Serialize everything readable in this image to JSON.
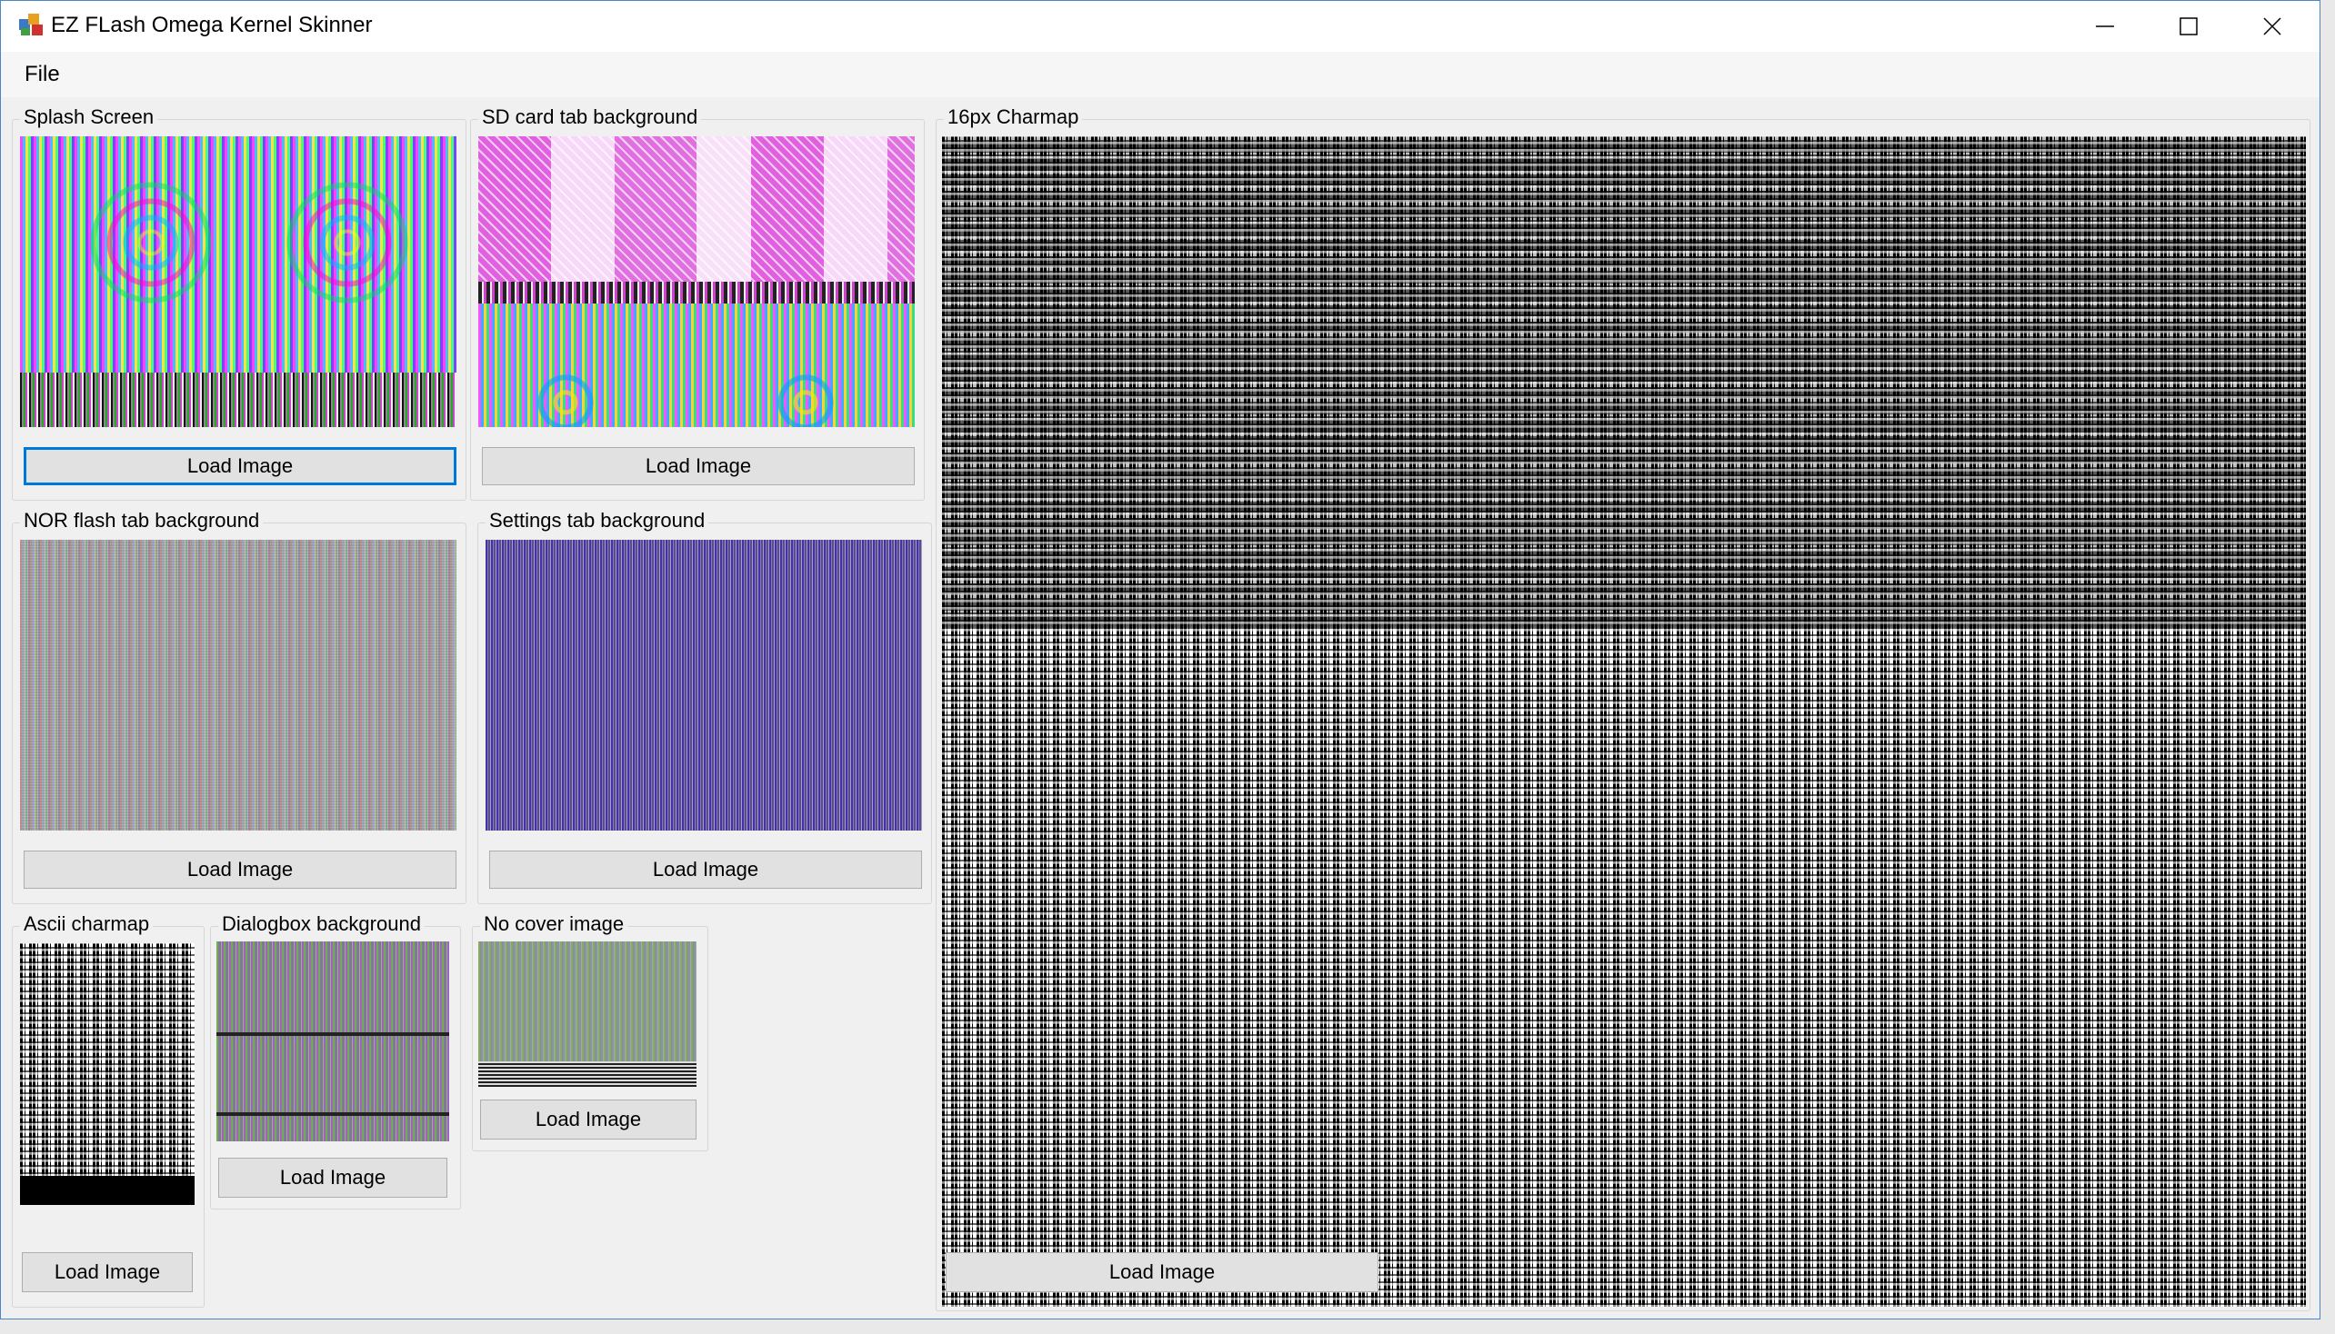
{
  "window": {
    "title": "EZ FLash Omega Kernel Skinner"
  },
  "menu": {
    "items": [
      {
        "label": "File"
      }
    ]
  },
  "groups": {
    "splash": {
      "legend": "Splash Screen",
      "button": "Load Image"
    },
    "sd_card": {
      "legend": "SD card tab background",
      "button": "Load Image"
    },
    "charmap16": {
      "legend": "16px Charmap",
      "button": "Load Image"
    },
    "nor_flash": {
      "legend": "NOR flash tab background",
      "button": "Load Image"
    },
    "settings": {
      "legend": "Settings tab background",
      "button": "Load Image"
    },
    "ascii": {
      "legend": "Ascii charmap",
      "button": "Load Image"
    },
    "dialogbox": {
      "legend": "Dialogbox background",
      "button": "Load Image"
    },
    "no_cover": {
      "legend": "No cover image",
      "button": "Load Image"
    }
  },
  "icons": {
    "app": "app-icon",
    "minimize": "minimize-icon",
    "maximize": "maximize-icon",
    "close": "close-icon"
  }
}
